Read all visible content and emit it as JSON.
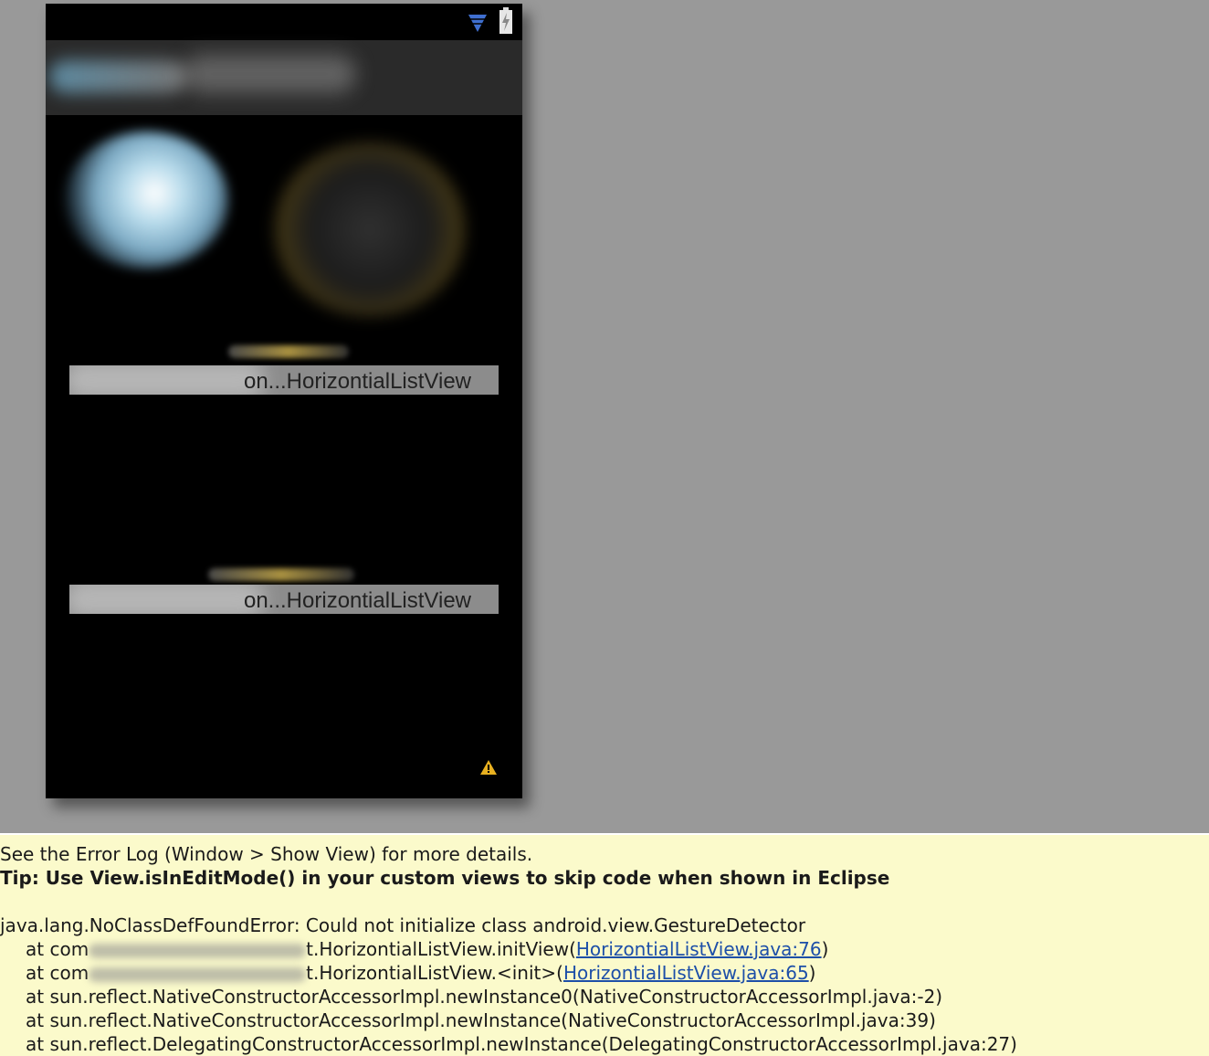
{
  "preview": {
    "listview_1_label": "on...HorizontialListView",
    "listview_2_label": "on...HorizontialListView"
  },
  "error_log": {
    "see_error_log": "See the Error Log (Window > Show View) for more details.",
    "tip": "Tip: Use View.isInEditMode() in your custom views to skip code when shown in Eclipse",
    "exception": "java.lang.NoClassDefFoundError: Could not initialize class android.view.GestureDetector",
    "trace": [
      {
        "prefix": "at com",
        "pkg_suffix": "t.HorizontialListView.initView(",
        "link": "HorizontialListView.java:76",
        "suffix": ")"
      },
      {
        "prefix": "at com",
        "pkg_suffix": "t.HorizontialListView.<init>(",
        "link": "HorizontialListView.java:65",
        "suffix": ")"
      },
      {
        "text": "at sun.reflect.NativeConstructorAccessorImpl.newInstance0(NativeConstructorAccessorImpl.java:-2)"
      },
      {
        "text": "at sun.reflect.NativeConstructorAccessorImpl.newInstance(NativeConstructorAccessorImpl.java:39)"
      },
      {
        "text": "at sun.reflect.DelegatingConstructorAccessorImpl.newInstance(DelegatingConstructorAccessorImpl.java:27)"
      }
    ]
  },
  "colors": {
    "canvas_bg": "#999999",
    "error_bg": "#fbfacb",
    "link": "#1d4fa8"
  },
  "icons": [
    "wifi-icon",
    "battery-icon",
    "warning-icon"
  ]
}
